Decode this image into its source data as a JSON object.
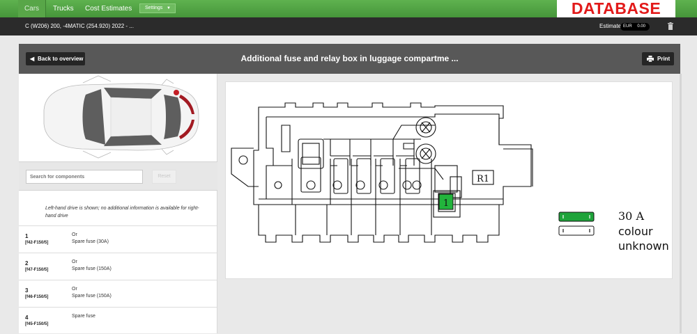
{
  "nav": {
    "tabs": [
      "Cars",
      "Trucks",
      "Cost Estimates"
    ],
    "settings_label": "Settings",
    "logo_text": "DATABASE"
  },
  "vehicle_bar": {
    "vehicle": "C (W206) 200, -4MATIC (254.920) 2022 - ...",
    "estimate_label": "Estimate",
    "currency": "EUR",
    "amount": "0.00"
  },
  "panel": {
    "back_label": "Back to overview",
    "title": "Additional fuse and relay box in luggage compartme ...",
    "print_label": "Print"
  },
  "search": {
    "placeholder": "Search for components",
    "reset_label": "Reset"
  },
  "notice": "Left-hand drive is shown; no additional information is available for right-hand drive",
  "components": [
    {
      "num": "1",
      "code": "[f42-F150/5]",
      "line1": "Or",
      "line2": "Spare fuse (30A)"
    },
    {
      "num": "2",
      "code": "[f47-F150/5]",
      "line1": "Or",
      "line2": "Spare fuse (150A)"
    },
    {
      "num": "3",
      "code": "[f46-F150/5]",
      "line1": "Or",
      "line2": "Spare fuse (150A)"
    },
    {
      "num": "4",
      "code": "[f45-F150/5]",
      "line1": "Spare fuse",
      "line2": ""
    }
  ],
  "diagram": {
    "relay_label": "R1",
    "fuse_label": "1",
    "legend": [
      {
        "label": "30 A",
        "color": "#1ea33a"
      },
      {
        "label_line1": "colour",
        "label_line2": "unknown",
        "color": "#ffffff"
      }
    ]
  },
  "colors": {
    "nav_green": "#4fa141",
    "logo_red": "#e21a1a",
    "fuse_green": "#22b43c",
    "car_marker": "#c41e26"
  }
}
